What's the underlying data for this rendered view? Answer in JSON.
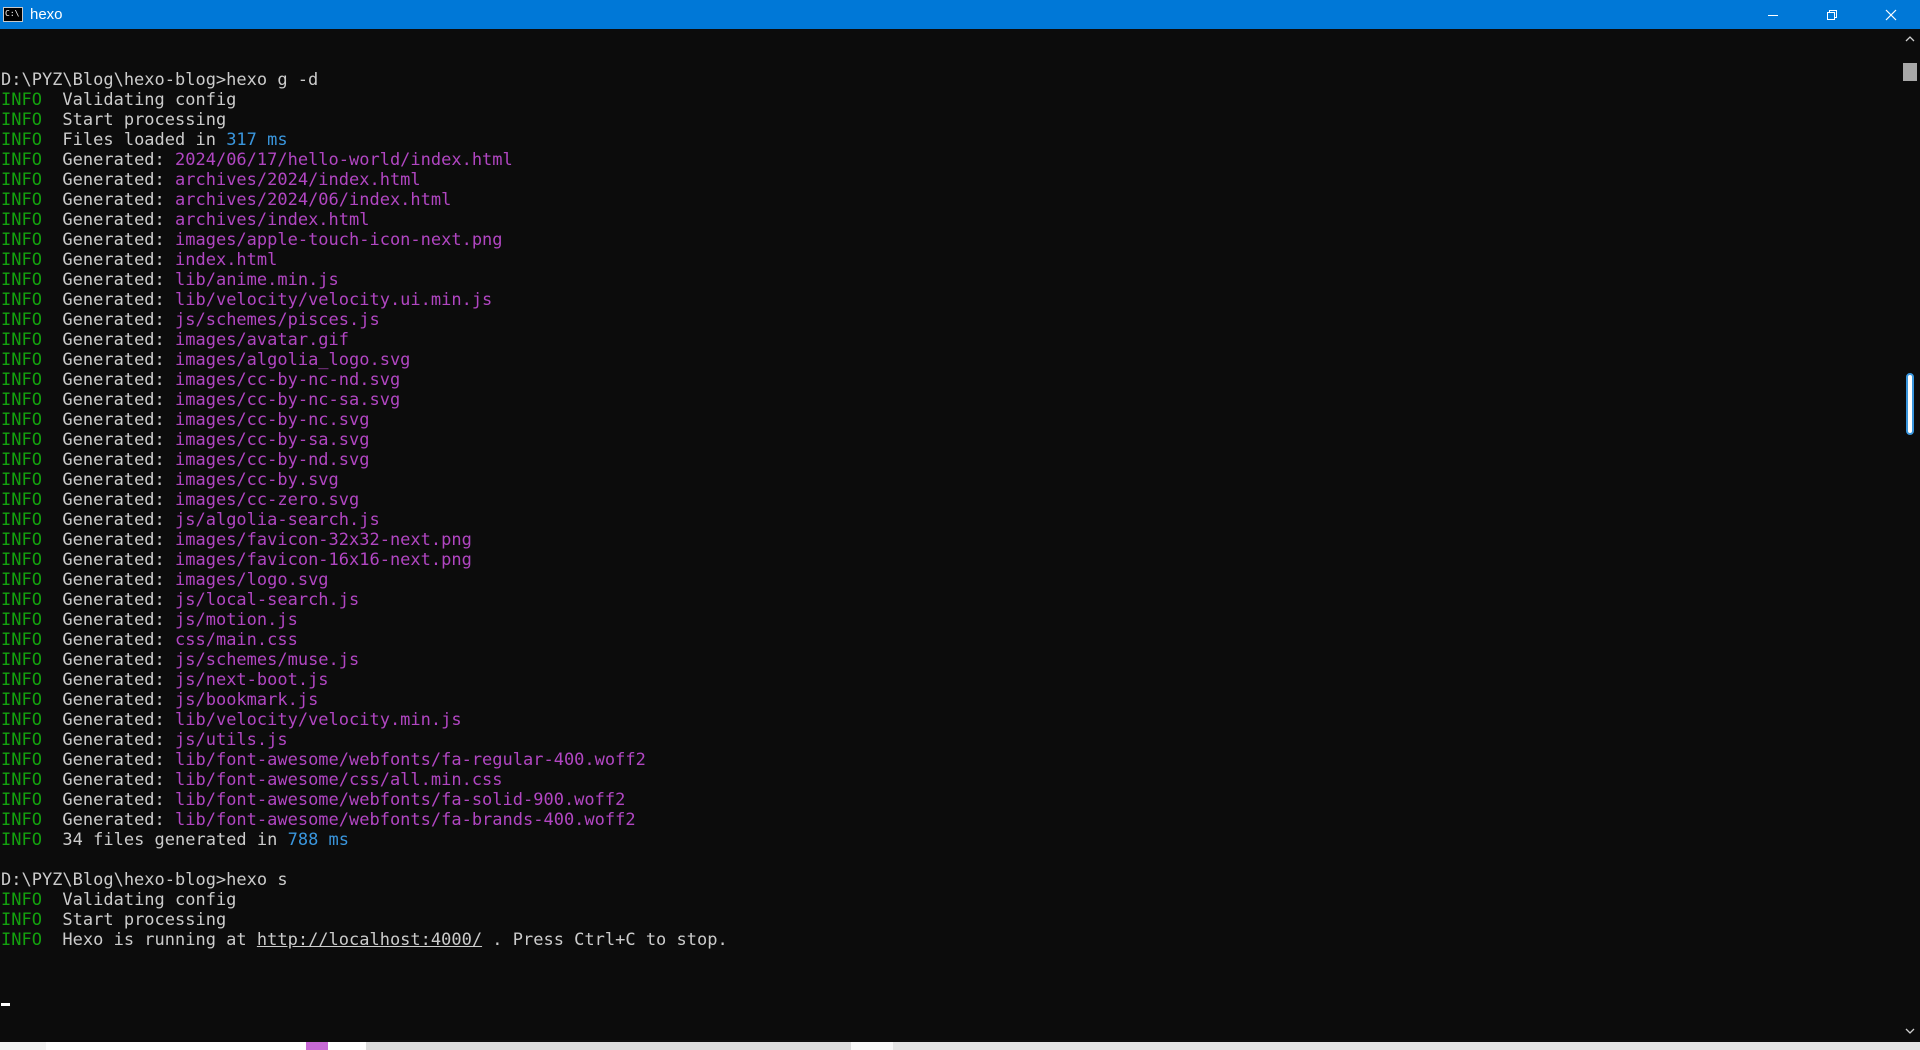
{
  "window": {
    "title": "hexo",
    "icon": "console-icon",
    "icon_glyph": "C:\\",
    "controls": [
      "minimize-icon",
      "restore-icon",
      "close-icon"
    ]
  },
  "colors": {
    "titlebar": "#0078d7",
    "background": "#0c0c0c",
    "text": "#cccccc",
    "info": "#13a10e",
    "path": "#b146c2",
    "number": "#3a96dd"
  },
  "console": {
    "lines": [
      {
        "segs": [
          {
            "t": "D:\\PYZ\\Blog\\hexo-blog>hexo g -d"
          }
        ]
      },
      {
        "segs": [
          {
            "t": "INFO",
            "c": "info"
          },
          {
            "t": "  Validating config"
          }
        ]
      },
      {
        "segs": [
          {
            "t": "INFO",
            "c": "info"
          },
          {
            "t": "  Start processing"
          }
        ]
      },
      {
        "segs": [
          {
            "t": "INFO",
            "c": "info"
          },
          {
            "t": "  Files loaded in "
          },
          {
            "t": "317 ms",
            "c": "num"
          }
        ]
      },
      {
        "segs": [
          {
            "t": "INFO",
            "c": "info"
          },
          {
            "t": "  Generated: "
          },
          {
            "t": "2024/06/17/hello-world/index.html",
            "c": "path"
          }
        ]
      },
      {
        "segs": [
          {
            "t": "INFO",
            "c": "info"
          },
          {
            "t": "  Generated: "
          },
          {
            "t": "archives/2024/index.html",
            "c": "path"
          }
        ]
      },
      {
        "segs": [
          {
            "t": "INFO",
            "c": "info"
          },
          {
            "t": "  Generated: "
          },
          {
            "t": "archives/2024/06/index.html",
            "c": "path"
          }
        ]
      },
      {
        "segs": [
          {
            "t": "INFO",
            "c": "info"
          },
          {
            "t": "  Generated: "
          },
          {
            "t": "archives/index.html",
            "c": "path"
          }
        ]
      },
      {
        "segs": [
          {
            "t": "INFO",
            "c": "info"
          },
          {
            "t": "  Generated: "
          },
          {
            "t": "images/apple-touch-icon-next.png",
            "c": "path"
          }
        ]
      },
      {
        "segs": [
          {
            "t": "INFO",
            "c": "info"
          },
          {
            "t": "  Generated: "
          },
          {
            "t": "index.html",
            "c": "path"
          }
        ]
      },
      {
        "segs": [
          {
            "t": "INFO",
            "c": "info"
          },
          {
            "t": "  Generated: "
          },
          {
            "t": "lib/anime.min.js",
            "c": "path"
          }
        ]
      },
      {
        "segs": [
          {
            "t": "INFO",
            "c": "info"
          },
          {
            "t": "  Generated: "
          },
          {
            "t": "lib/velocity/velocity.ui.min.js",
            "c": "path"
          }
        ]
      },
      {
        "segs": [
          {
            "t": "INFO",
            "c": "info"
          },
          {
            "t": "  Generated: "
          },
          {
            "t": "js/schemes/pisces.js",
            "c": "path"
          }
        ]
      },
      {
        "segs": [
          {
            "t": "INFO",
            "c": "info"
          },
          {
            "t": "  Generated: "
          },
          {
            "t": "images/avatar.gif",
            "c": "path"
          }
        ]
      },
      {
        "segs": [
          {
            "t": "INFO",
            "c": "info"
          },
          {
            "t": "  Generated: "
          },
          {
            "t": "images/algolia_logo.svg",
            "c": "path"
          }
        ]
      },
      {
        "segs": [
          {
            "t": "INFO",
            "c": "info"
          },
          {
            "t": "  Generated: "
          },
          {
            "t": "images/cc-by-nc-nd.svg",
            "c": "path"
          }
        ]
      },
      {
        "segs": [
          {
            "t": "INFO",
            "c": "info"
          },
          {
            "t": "  Generated: "
          },
          {
            "t": "images/cc-by-nc-sa.svg",
            "c": "path"
          }
        ]
      },
      {
        "segs": [
          {
            "t": "INFO",
            "c": "info"
          },
          {
            "t": "  Generated: "
          },
          {
            "t": "images/cc-by-nc.svg",
            "c": "path"
          }
        ]
      },
      {
        "segs": [
          {
            "t": "INFO",
            "c": "info"
          },
          {
            "t": "  Generated: "
          },
          {
            "t": "images/cc-by-sa.svg",
            "c": "path"
          }
        ]
      },
      {
        "segs": [
          {
            "t": "INFO",
            "c": "info"
          },
          {
            "t": "  Generated: "
          },
          {
            "t": "images/cc-by-nd.svg",
            "c": "path"
          }
        ]
      },
      {
        "segs": [
          {
            "t": "INFO",
            "c": "info"
          },
          {
            "t": "  Generated: "
          },
          {
            "t": "images/cc-by.svg",
            "c": "path"
          }
        ]
      },
      {
        "segs": [
          {
            "t": "INFO",
            "c": "info"
          },
          {
            "t": "  Generated: "
          },
          {
            "t": "images/cc-zero.svg",
            "c": "path"
          }
        ]
      },
      {
        "segs": [
          {
            "t": "INFO",
            "c": "info"
          },
          {
            "t": "  Generated: "
          },
          {
            "t": "js/algolia-search.js",
            "c": "path"
          }
        ]
      },
      {
        "segs": [
          {
            "t": "INFO",
            "c": "info"
          },
          {
            "t": "  Generated: "
          },
          {
            "t": "images/favicon-32x32-next.png",
            "c": "path"
          }
        ]
      },
      {
        "segs": [
          {
            "t": "INFO",
            "c": "info"
          },
          {
            "t": "  Generated: "
          },
          {
            "t": "images/favicon-16x16-next.png",
            "c": "path"
          }
        ]
      },
      {
        "segs": [
          {
            "t": "INFO",
            "c": "info"
          },
          {
            "t": "  Generated: "
          },
          {
            "t": "images/logo.svg",
            "c": "path"
          }
        ]
      },
      {
        "segs": [
          {
            "t": "INFO",
            "c": "info"
          },
          {
            "t": "  Generated: "
          },
          {
            "t": "js/local-search.js",
            "c": "path"
          }
        ]
      },
      {
        "segs": [
          {
            "t": "INFO",
            "c": "info"
          },
          {
            "t": "  Generated: "
          },
          {
            "t": "js/motion.js",
            "c": "path"
          }
        ]
      },
      {
        "segs": [
          {
            "t": "INFO",
            "c": "info"
          },
          {
            "t": "  Generated: "
          },
          {
            "t": "css/main.css",
            "c": "path"
          }
        ]
      },
      {
        "segs": [
          {
            "t": "INFO",
            "c": "info"
          },
          {
            "t": "  Generated: "
          },
          {
            "t": "js/schemes/muse.js",
            "c": "path"
          }
        ]
      },
      {
        "segs": [
          {
            "t": "INFO",
            "c": "info"
          },
          {
            "t": "  Generated: "
          },
          {
            "t": "js/next-boot.js",
            "c": "path"
          }
        ]
      },
      {
        "segs": [
          {
            "t": "INFO",
            "c": "info"
          },
          {
            "t": "  Generated: "
          },
          {
            "t": "js/bookmark.js",
            "c": "path"
          }
        ]
      },
      {
        "segs": [
          {
            "t": "INFO",
            "c": "info"
          },
          {
            "t": "  Generated: "
          },
          {
            "t": "lib/velocity/velocity.min.js",
            "c": "path"
          }
        ]
      },
      {
        "segs": [
          {
            "t": "INFO",
            "c": "info"
          },
          {
            "t": "  Generated: "
          },
          {
            "t": "js/utils.js",
            "c": "path"
          }
        ]
      },
      {
        "segs": [
          {
            "t": "INFO",
            "c": "info"
          },
          {
            "t": "  Generated: "
          },
          {
            "t": "lib/font-awesome/webfonts/fa-regular-400.woff2",
            "c": "path"
          }
        ]
      },
      {
        "segs": [
          {
            "t": "INFO",
            "c": "info"
          },
          {
            "t": "  Generated: "
          },
          {
            "t": "lib/font-awesome/css/all.min.css",
            "c": "path"
          }
        ]
      },
      {
        "segs": [
          {
            "t": "INFO",
            "c": "info"
          },
          {
            "t": "  Generated: "
          },
          {
            "t": "lib/font-awesome/webfonts/fa-solid-900.woff2",
            "c": "path"
          }
        ]
      },
      {
        "segs": [
          {
            "t": "INFO",
            "c": "info"
          },
          {
            "t": "  Generated: "
          },
          {
            "t": "lib/font-awesome/webfonts/fa-brands-400.woff2",
            "c": "path"
          }
        ]
      },
      {
        "segs": [
          {
            "t": "INFO",
            "c": "info"
          },
          {
            "t": "  34 files generated in "
          },
          {
            "t": "788 ms",
            "c": "num"
          }
        ]
      },
      {
        "segs": [
          {
            "t": ""
          }
        ]
      },
      {
        "segs": [
          {
            "t": "D:\\PYZ\\Blog\\hexo-blog>hexo s"
          }
        ]
      },
      {
        "segs": [
          {
            "t": "INFO",
            "c": "info"
          },
          {
            "t": "  Validating config"
          }
        ]
      },
      {
        "segs": [
          {
            "t": "INFO",
            "c": "info"
          },
          {
            "t": "  Start processing"
          }
        ]
      },
      {
        "segs": [
          {
            "t": "INFO",
            "c": "info"
          },
          {
            "t": "  Hexo is running at "
          },
          {
            "t": "http://localhost:4000/",
            "c": "url"
          },
          {
            "t": " . Press Ctrl+C to stop."
          }
        ]
      }
    ]
  }
}
